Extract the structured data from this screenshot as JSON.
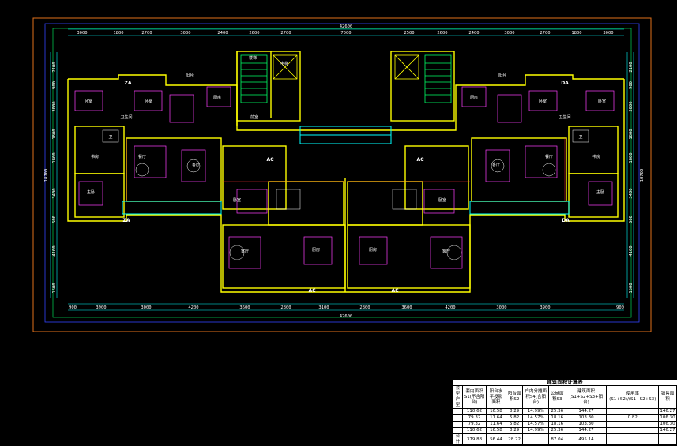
{
  "drawing": {
    "overall_dim_top": "42600",
    "overall_dim_bottom": "42600",
    "dims_top": [
      "3000",
      "1800",
      "2700",
      "3000",
      "2400",
      "2600",
      "2700",
      "7000",
      "2500",
      "2600",
      "2400",
      "3000",
      "2700",
      "1800",
      "3000"
    ],
    "dims_bottom": [
      "900",
      "3900",
      "3000",
      "4200",
      "3600",
      "2800",
      "3100",
      "2800",
      "3600",
      "4200",
      "3000",
      "3900",
      "900"
    ],
    "dims_left": [
      "2100",
      "900",
      "3000",
      "1800",
      "1800",
      "3400",
      "600",
      "4100",
      "1500"
    ],
    "dims_right": [
      "2100",
      "900",
      "3000",
      "1800",
      "1800",
      "3400",
      "600",
      "4100",
      "1500"
    ],
    "side_total_left": "18700",
    "side_total_right": "18700",
    "unit_tags": [
      "ZA",
      "ZA",
      "DA",
      "DA",
      "AC",
      "AC",
      "AC",
      "AC"
    ],
    "room_labels": [
      "卧室",
      "卧室",
      "卫生间",
      "客厅",
      "餐厅",
      "厨房",
      "阳台",
      "书房",
      "主卧",
      "卫",
      "卧室",
      "卧室",
      "卫生间",
      "客厅",
      "餐厅",
      "厨房",
      "阳台",
      "书房",
      "主卧",
      "卫",
      "电梯",
      "楼梯",
      "前室",
      "卧室",
      "卧室",
      "客厅",
      "客厅",
      "厨房",
      "厨房"
    ]
  },
  "colors": {
    "background": "#000000",
    "frame": "#e0701a",
    "wall": "#ffff00",
    "dim_line": "#00ffff",
    "axis": "#3344ff",
    "furniture": "#ff40ff",
    "inner": "#ff3030",
    "fixture": "#ffffff"
  },
  "area_table": {
    "title": "建筑面积计算表",
    "headers": [
      "套型户型",
      "套内面积S1(不含阳台)",
      "阳台水平投影面积",
      "阳台面积S2",
      "户内分摊面积S4(含阳台)",
      "公摊面积S3",
      "建筑面积(S1+S2+S3+阳台)",
      "使用率(S1+S2)/(S1+S2+S3)",
      "销售面积"
    ],
    "rows": [
      [
        "",
        "110.62",
        "16.58",
        "8.29",
        "14.99%",
        "25.36",
        "144.27",
        "",
        "146.27"
      ],
      [
        "",
        "79.32",
        "11.64",
        "5.82",
        "14.57%",
        "18.16",
        "103.30",
        "0.82",
        "106.30"
      ],
      [
        "",
        "79.32",
        "11.64",
        "5.82",
        "14.57%",
        "18.16",
        "103.30",
        "",
        "106.30"
      ],
      [
        "",
        "110.62",
        "16.58",
        "8.29",
        "14.99%",
        "25.36",
        "144.27",
        "",
        "146.27"
      ]
    ],
    "total": [
      "合计",
      "379.88",
      "56.44",
      "28.22",
      "",
      "87.04",
      "495.14",
      "",
      ""
    ]
  }
}
